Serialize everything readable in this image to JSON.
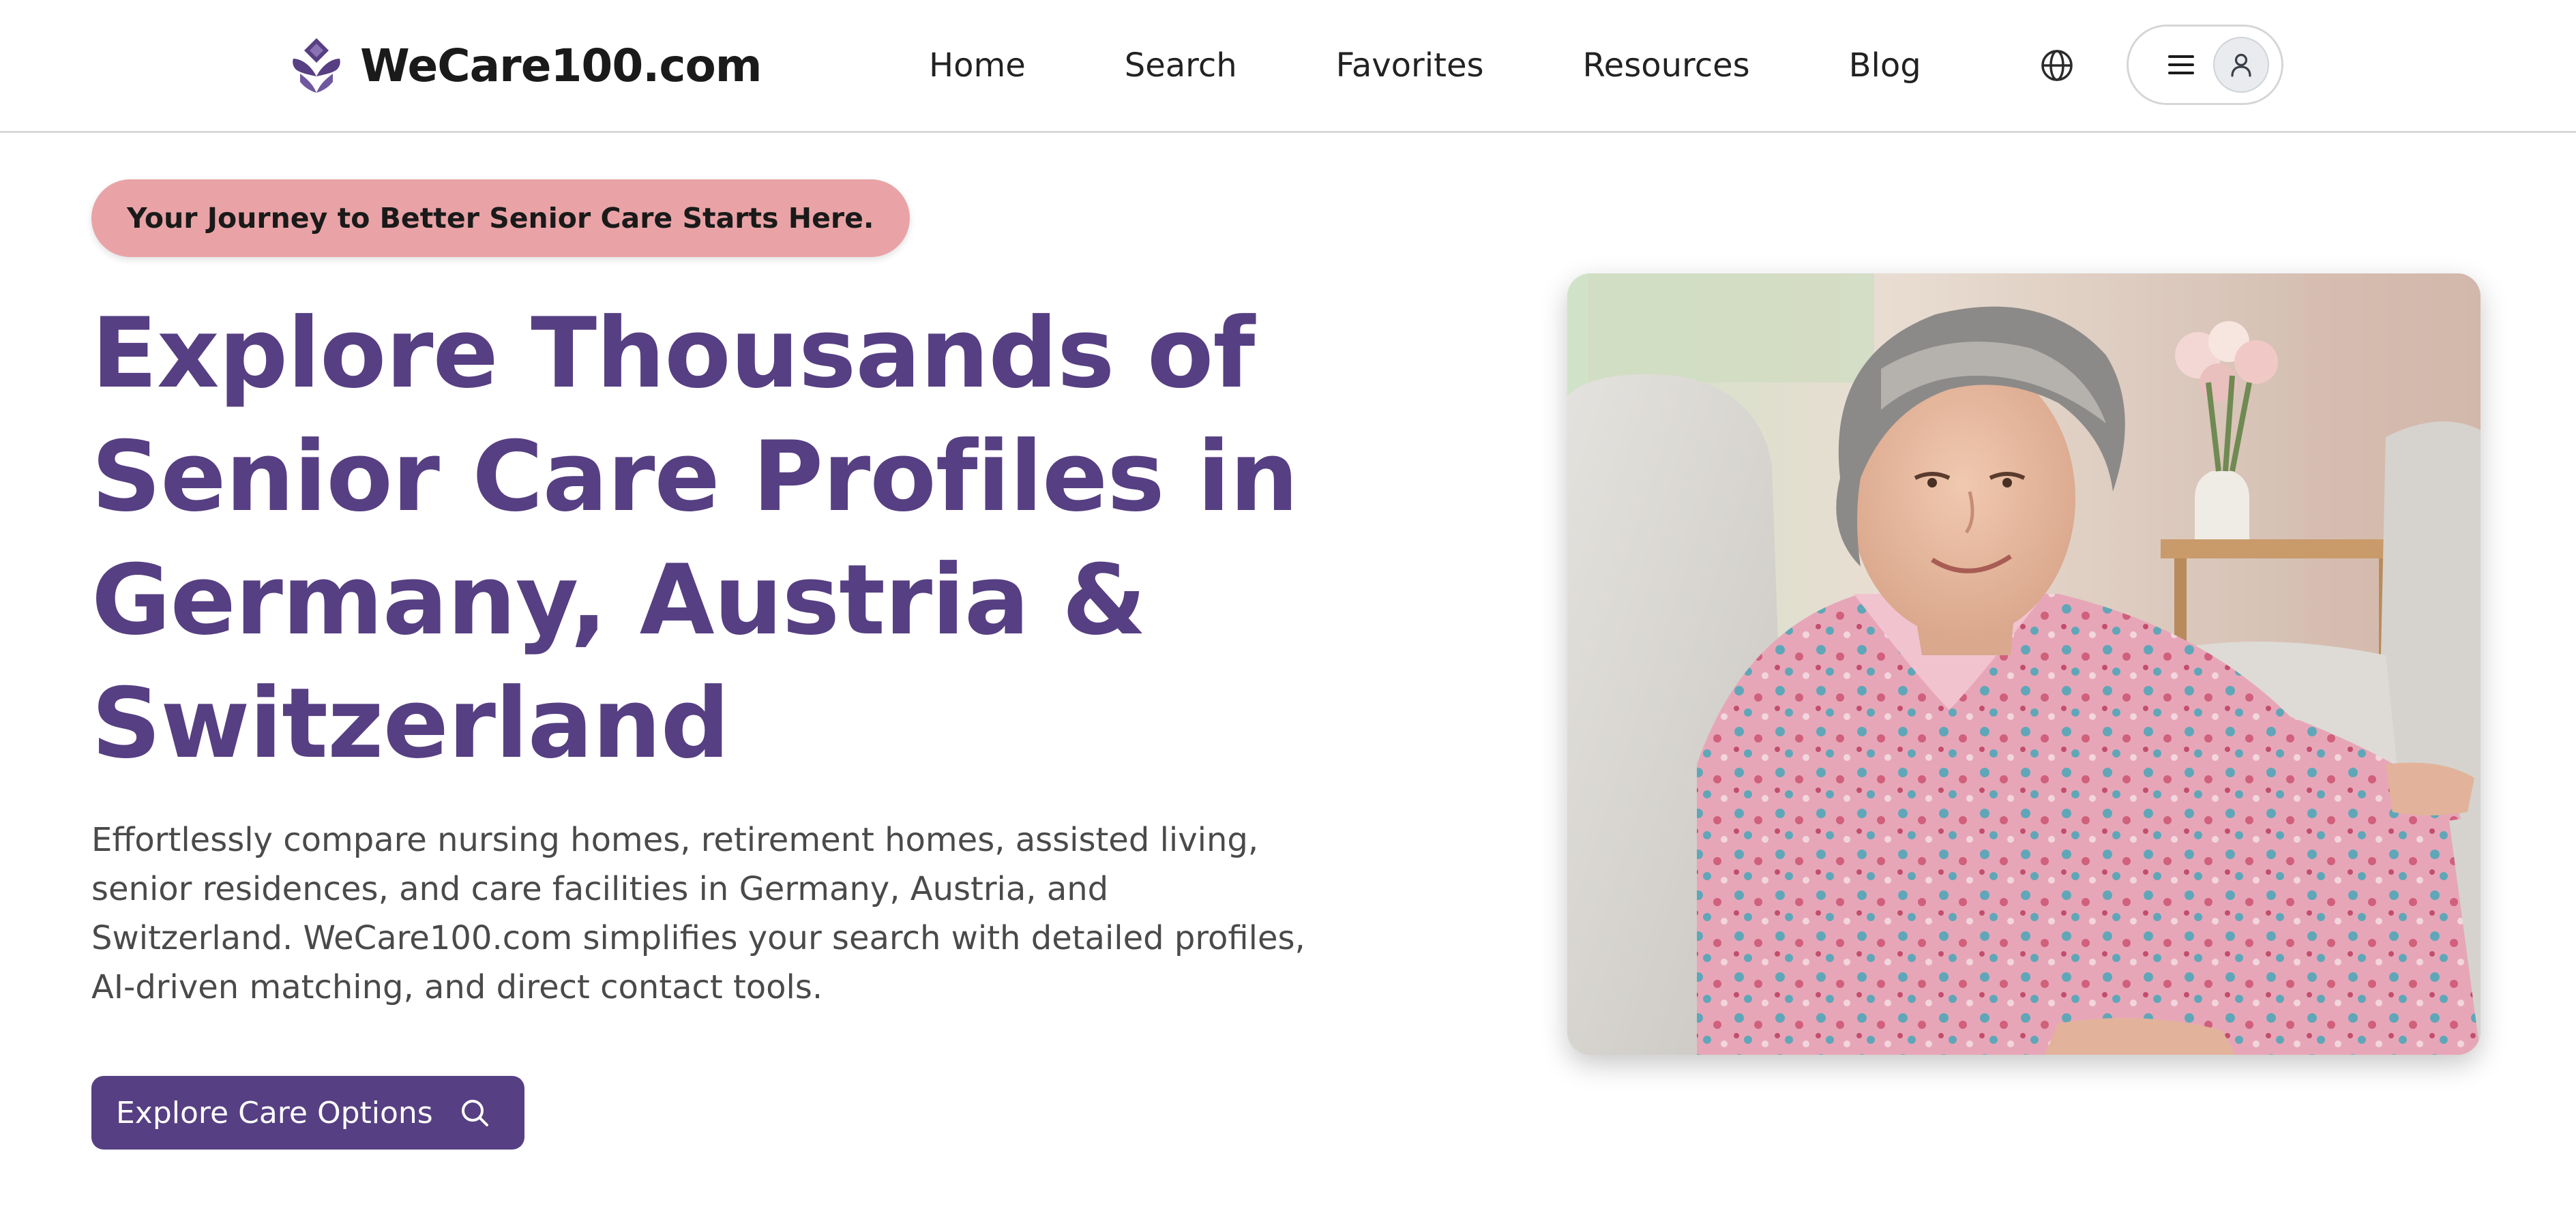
{
  "brand": {
    "name": "WeCare100.com",
    "color": "#563f82"
  },
  "nav": {
    "items": [
      {
        "label": "Home"
      },
      {
        "label": "Search"
      },
      {
        "label": "Favorites"
      },
      {
        "label": "Resources"
      },
      {
        "label": "Blog"
      }
    ]
  },
  "header_icons": {
    "language": "globe-icon",
    "menu": "hamburger-menu-icon",
    "account": "user-icon"
  },
  "hero": {
    "tagline": "Your Journey to Better Senior Care Starts Here.",
    "title": "Explore Thousands of Senior Care Profiles in Germany, Austria & Switzerland",
    "description": "Effortlessly compare nursing homes, retirement homes, assisted living, senior residences, and care facilities in Germany, Austria, and Switzerland. WeCare100.com simplifies your search with detailed profiles, AI-driven matching, and direct contact tools.",
    "cta_label": "Explore Care Options",
    "cta_icon": "search-icon",
    "tagline_bg": "#e9a3a6",
    "title_color": "#563f82"
  }
}
